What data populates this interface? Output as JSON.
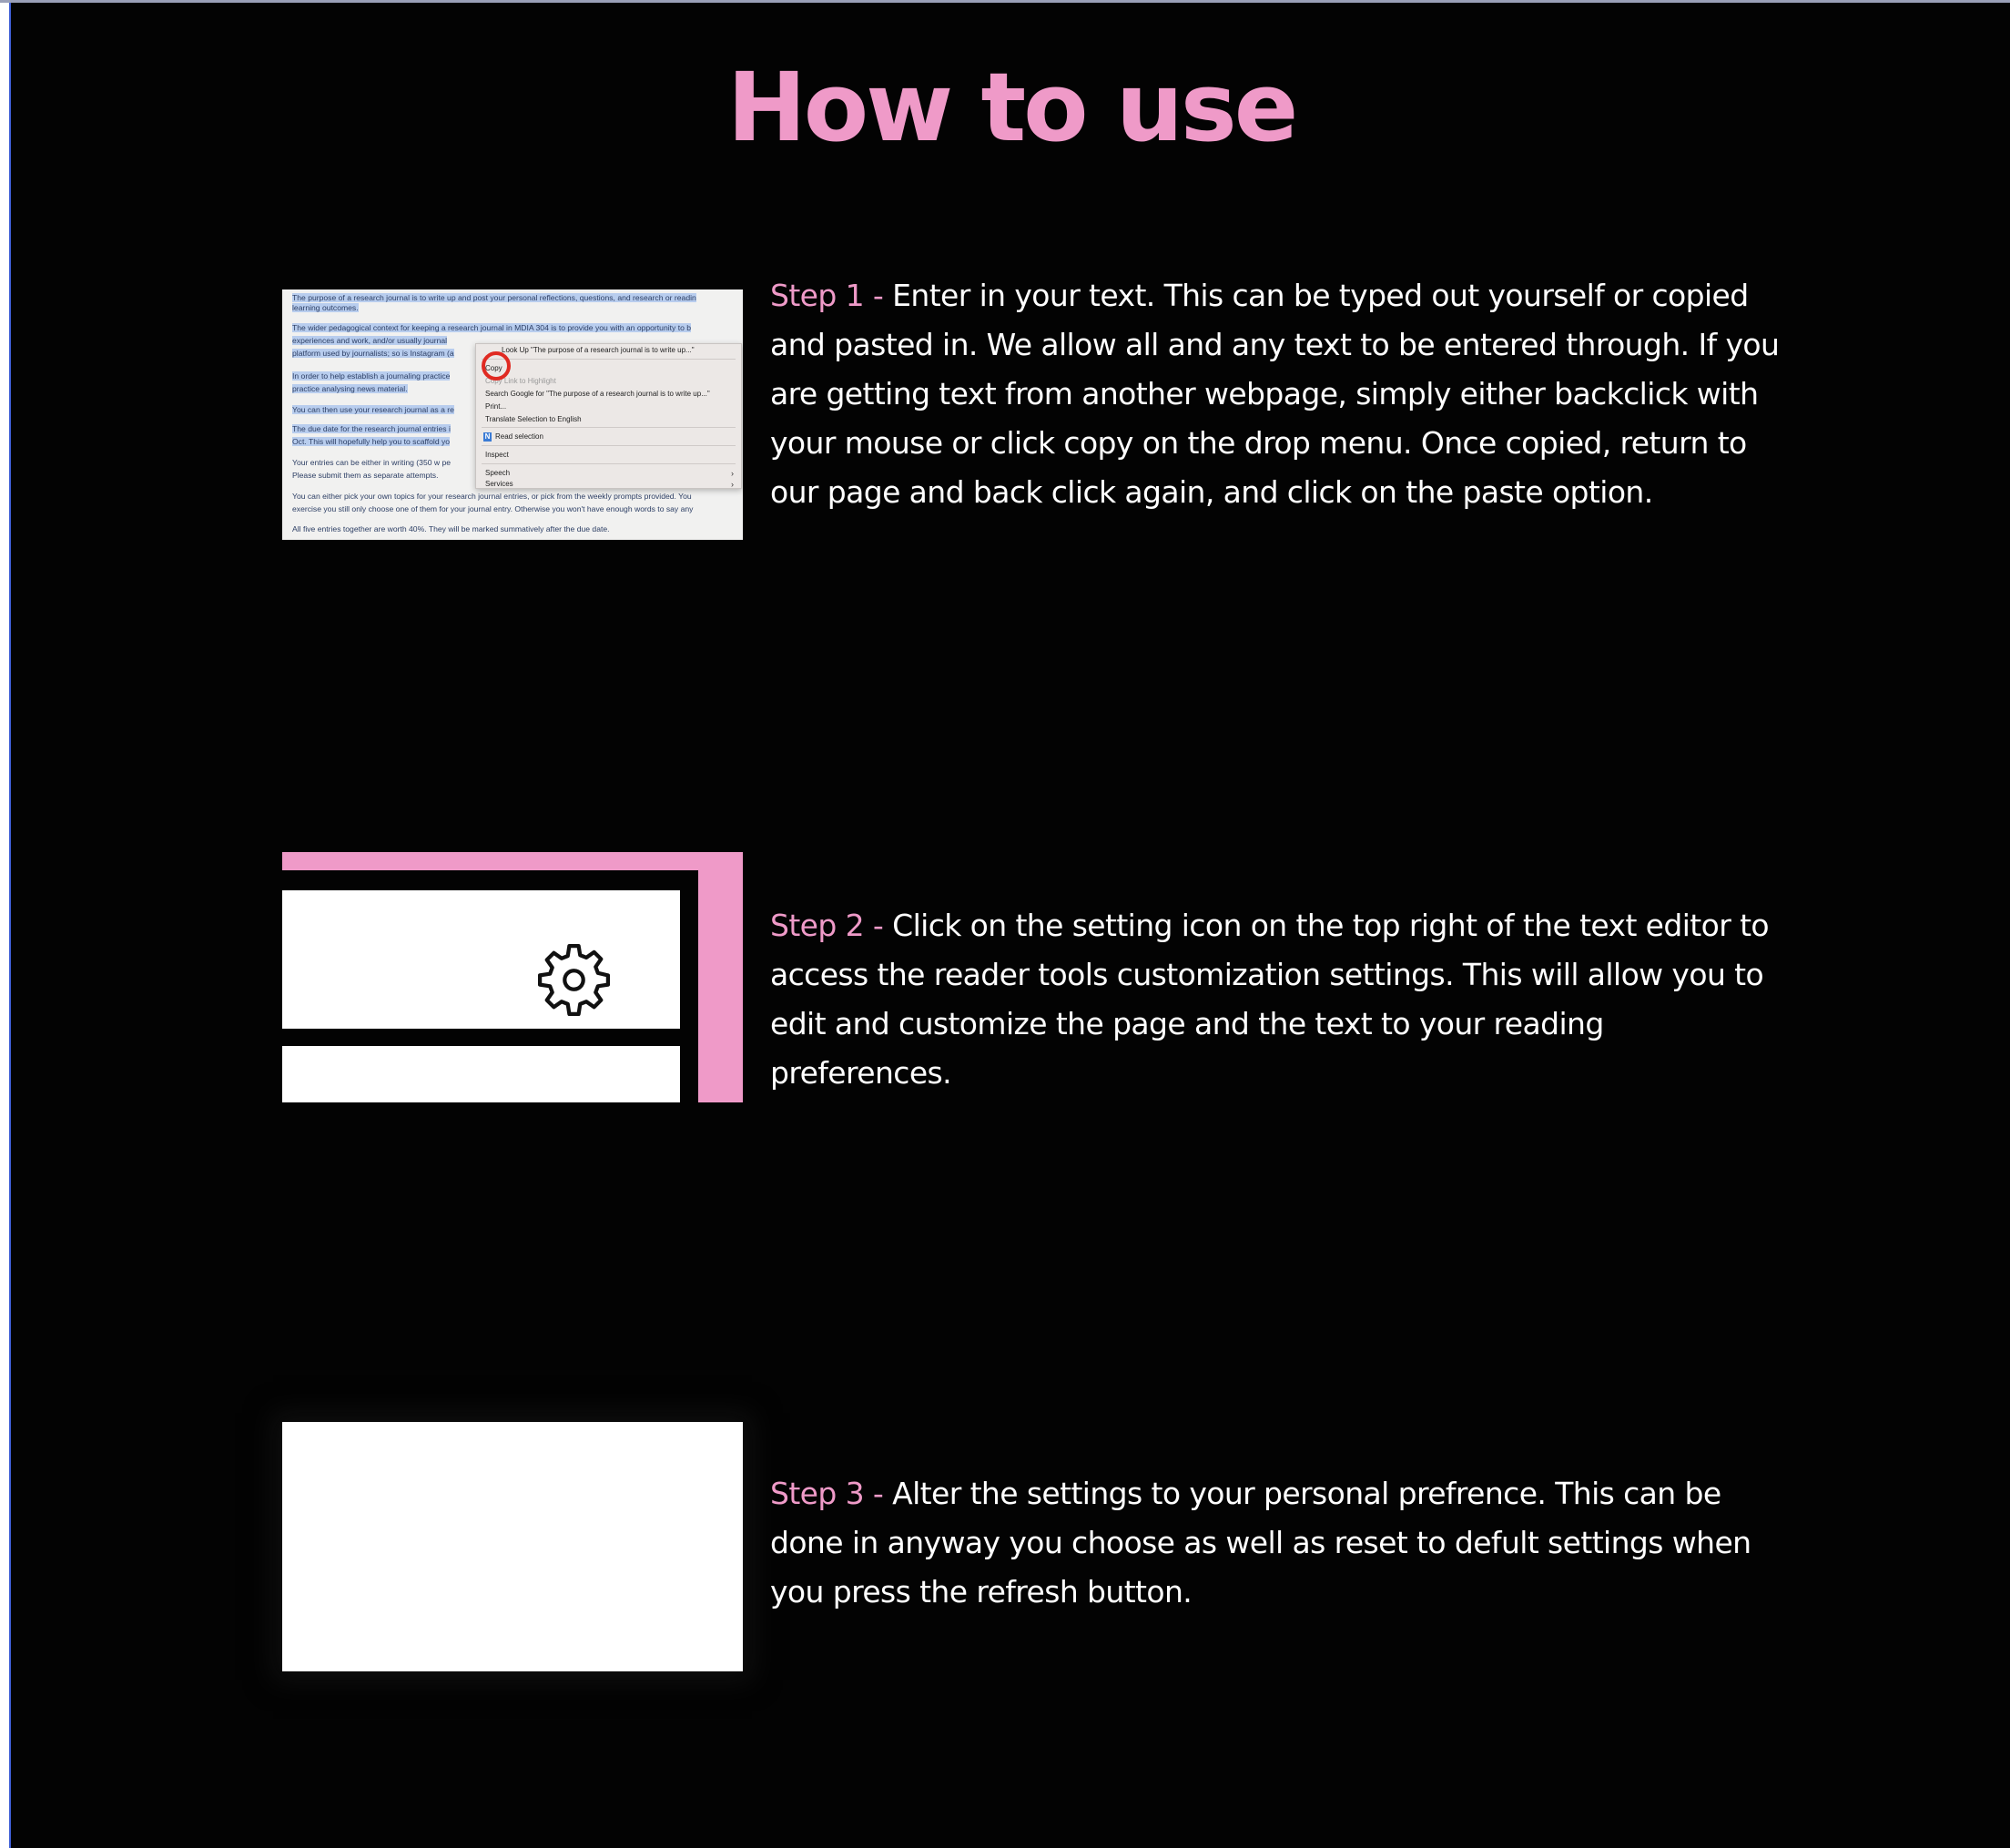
{
  "page": {
    "title": "How to use"
  },
  "steps": [
    {
      "label": "Step 1 -",
      "text": " Enter in your text. This can be typed out yourself or copied and pasted in. We allow all and any text to be entered through. If you are getting text from another webpage, simply either backclick with your mouse or click copy on the drop menu. Once copied, return to our page and back click again, and click on the paste option."
    },
    {
      "label": "Step 2 -",
      "text": " Click on the setting icon on the top right of the text editor to access the reader tools customization settings. This will allow you to edit and customize the page and the text to your reading preferences."
    },
    {
      "label": "Step 3 -",
      "text": " Alter the settings to your personal prefrence. This can be done in anyway you choose as well as reset to defult settings when you press the refresh button."
    }
  ],
  "step1_screenshot": {
    "doc_lines": [
      "The purpose of a research journal is to write up and post your personal reflections, questions, and research or readin",
      "learning outcomes.",
      "The wider pedagogical context for keeping a research journal in MDIA 304 is to provide you with an opportunity to b",
      "experiences and work, and/or usually journal",
      "platform used by journalists; so is Instagram (a",
      "In order to help establish a journaling practice",
      "practice analysing news material.",
      "You can then use your research journal as a re",
      "The due date for the research journal entries i",
      "Oct. This will hopefully help you to scaffold yo",
      "Your entries can be either in writing (350 w pe",
      "Please submit them as separate attempts.",
      "You can either pick your own topics for your research journal entries, or pick from the weekly prompts provided. You",
      "exercise you still only choose one of them for your journal entry. Otherwise you won't have enough words to say any",
      "All five entries together are worth 40%. They will be marked summatively after the due date."
    ],
    "menu_items": {
      "lookup": "Look Up \"The purpose of a research journal is to write up...\"",
      "copy": "Copy",
      "highlight": "Copy Link to Highlight",
      "search": "Search Google for \"The purpose of a research journal is to write up...\"",
      "print": "Print...",
      "translate": "Translate Selection to English",
      "read": "Read selection",
      "inspect": "Inspect",
      "speech": "Speech",
      "services": "Services"
    },
    "submenu_arrow": "›"
  },
  "icons": {
    "step2": "gear-icon"
  },
  "colors": {
    "accent_pink": "#ef9ac8",
    "background": "#030303",
    "text": "#ffffff"
  }
}
